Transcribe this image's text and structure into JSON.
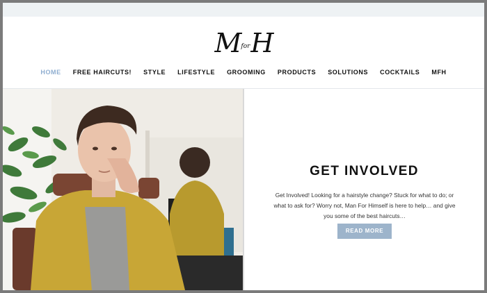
{
  "brand": {
    "logo_left": "M",
    "logo_for": "for",
    "logo_right": "H"
  },
  "nav": [
    {
      "label": "HOME",
      "active": true
    },
    {
      "label": "FREE HAIRCUTS!",
      "active": false
    },
    {
      "label": "STYLE",
      "active": false
    },
    {
      "label": "LIFESTYLE",
      "active": false
    },
    {
      "label": "GROOMING",
      "active": false
    },
    {
      "label": "PRODUCTS",
      "active": false
    },
    {
      "label": "SOLUTIONS",
      "active": false
    },
    {
      "label": "COCKTAILS",
      "active": false
    },
    {
      "label": "MFH",
      "active": false
    }
  ],
  "hero": {
    "title": "GET INVOLVED",
    "body": "Get Involved! Looking for a hairstyle change? Stuck for what to do; or what to ask for? Worry not, Man For Himself is here to help… and give you some of the best haircuts…",
    "button": "READ MORE"
  },
  "colors": {
    "accent": "#8faed0",
    "button": "#9db4cb",
    "text": "#111111",
    "topbar": "#eef2f4"
  }
}
